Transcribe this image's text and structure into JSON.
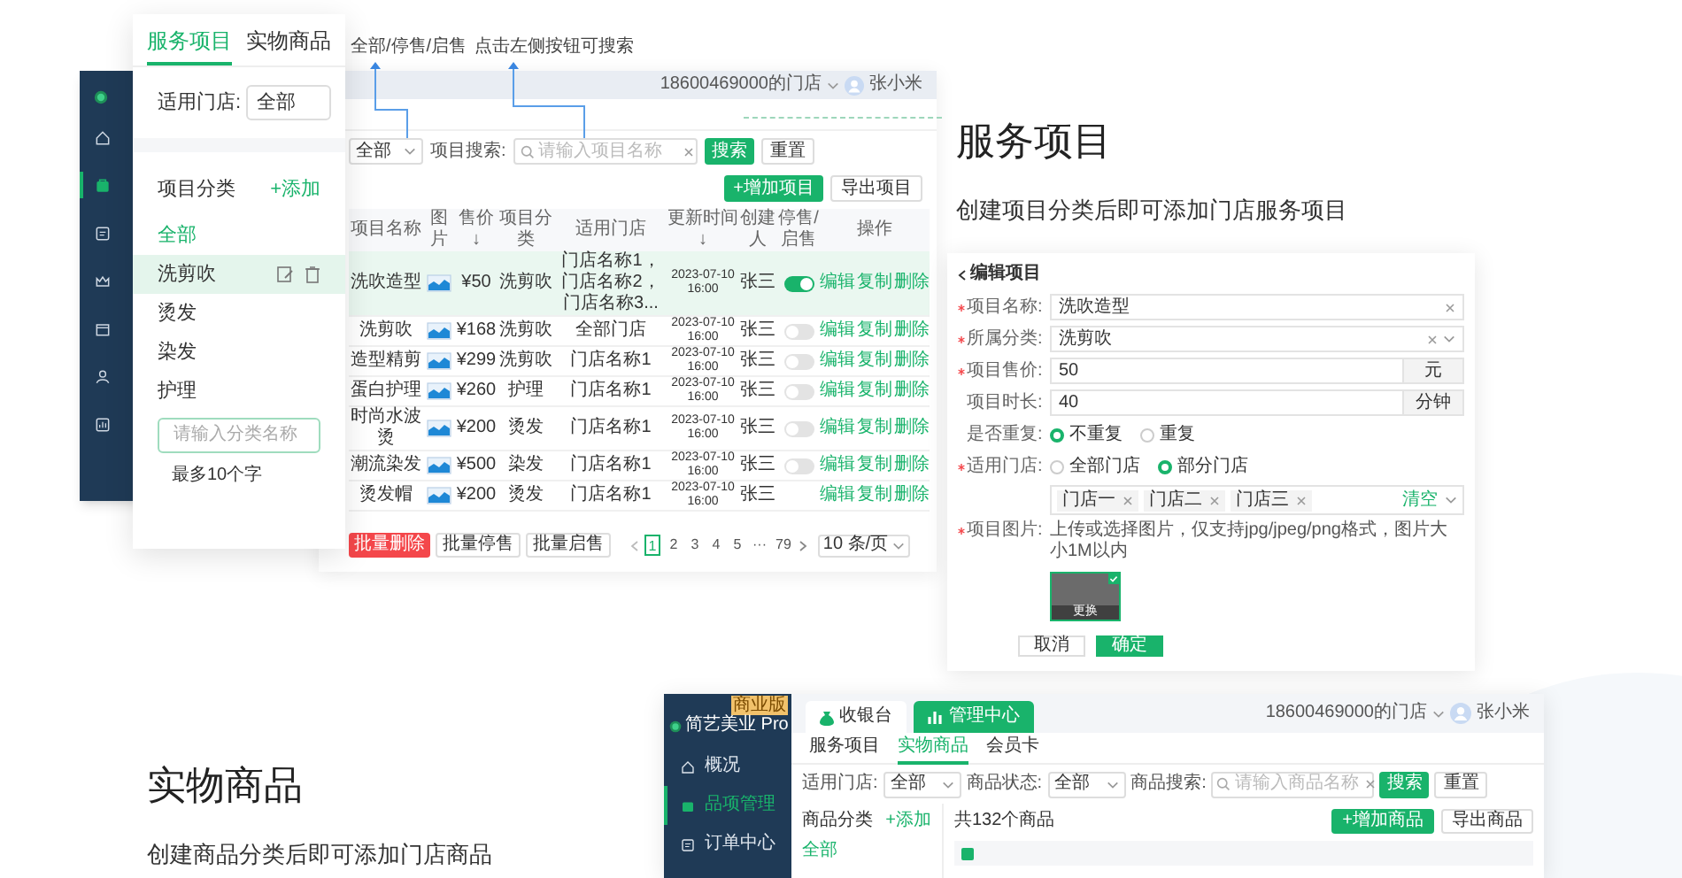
{
  "left_sidebar": {
    "items": [
      {
        "selected": false
      },
      {
        "selected": true
      },
      {
        "selected": false
      },
      {
        "selected": false
      },
      {
        "selected": false
      },
      {
        "selected": false
      },
      {
        "selected": false
      }
    ]
  },
  "category_panel": {
    "tabs": [
      {
        "label": "服务项目",
        "selected": true
      },
      {
        "label": "实物商品",
        "selected": false
      }
    ],
    "store_filter": {
      "label": "适用门店:",
      "value": "全部"
    },
    "heading": "项目分类",
    "add_link": "+添加",
    "categories": [
      {
        "label": "全部",
        "selected": true,
        "hovered": false
      },
      {
        "label": "洗剪吹",
        "selected": false,
        "hovered": true
      },
      {
        "label": "烫发",
        "selected": false,
        "hovered": false
      },
      {
        "label": "染发",
        "selected": false,
        "hovered": false
      },
      {
        "label": "护理",
        "selected": false,
        "hovered": false
      }
    ],
    "new_category": {
      "placeholder": "请输入分类名称"
    },
    "hint": "最多10个字"
  },
  "annotations": [
    "全部/停售/启售",
    "点击左侧按钮可搜索"
  ],
  "service_window": {
    "store": "18600469000的门店",
    "user": "张小米",
    "filter": {
      "status_value": "全部",
      "search_label": "项目搜索:",
      "search_placeholder": "请输入项目名称",
      "search_button": "搜索",
      "reset_button": "重置"
    },
    "add_button": "+增加项目",
    "export_button": "导出项目",
    "columns": [
      "项目名称",
      "图片",
      "售价↓",
      "项目分类",
      "适用门店",
      "更新时间↓",
      "创建人",
      "停售/启售",
      "操作"
    ],
    "rows": [
      {
        "name": "洗吹造型",
        "price": "¥50",
        "category": "洗剪吹",
        "stores": "门店名称1，门店名称2，门店名称3...",
        "updated": "2023-07-10 16:00",
        "creator": "张三",
        "on": true,
        "selected": true,
        "actions": [
          "编辑",
          "复制",
          "删除"
        ]
      },
      {
        "name": "洗剪吹",
        "price": "¥168",
        "category": "洗剪吹",
        "stores": "全部门店",
        "updated": "2023-07-10 16:00",
        "creator": "张三",
        "on": false,
        "selected": false,
        "actions": [
          "编辑",
          "复制",
          "删除"
        ]
      },
      {
        "name": "造型精剪",
        "price": "¥299",
        "category": "洗剪吹",
        "stores": "门店名称1",
        "updated": "2023-07-10 16:00",
        "creator": "张三",
        "on": false,
        "selected": false,
        "actions": [
          "编辑",
          "复制",
          "删除"
        ]
      },
      {
        "name": "蛋白护理",
        "price": "¥260",
        "category": "护理",
        "stores": "门店名称1",
        "updated": "2023-07-10 16:00",
        "creator": "张三",
        "on": false,
        "selected": false,
        "actions": [
          "编辑",
          "复制",
          "删除"
        ]
      },
      {
        "name": "时尚水波烫",
        "price": "¥200",
        "category": "烫发",
        "stores": "门店名称1",
        "updated": "2023-07-10 16:00",
        "creator": "张三",
        "on": false,
        "selected": false,
        "actions": [
          "编辑",
          "复制",
          "删除"
        ]
      },
      {
        "name": "潮流染发",
        "price": "¥500",
        "category": "染发",
        "stores": "门店名称1",
        "updated": "2023-07-10 16:00",
        "creator": "张三",
        "on": false,
        "selected": false,
        "actions": [
          "编辑",
          "复制",
          "删除"
        ]
      },
      {
        "name": "烫发帽",
        "price": "¥200",
        "category": "烫发",
        "stores": "门店名称1",
        "updated": "2023-07-10 16:00",
        "creator": "张三",
        "selected": false,
        "actions": [
          "编辑",
          "复制",
          "删除"
        ]
      }
    ],
    "bulk_buttons": [
      {
        "label": "批量删除",
        "kind": "danger"
      },
      {
        "label": "批量停售",
        "kind": "plain"
      },
      {
        "label": "批量启售",
        "kind": "plain"
      }
    ],
    "pages": [
      {
        "label": "1",
        "selected": true
      },
      {
        "label": "2",
        "selected": false
      },
      {
        "label": "3",
        "selected": false
      },
      {
        "label": "4",
        "selected": false
      },
      {
        "label": "5",
        "selected": false
      },
      {
        "label": "···",
        "selected": false
      },
      {
        "label": "79",
        "selected": false
      }
    ],
    "page_size": "10 条/页"
  },
  "section_service": {
    "title": "服务项目",
    "subtitle": "创建项目分类后即可添加门店服务项目"
  },
  "edit_form": {
    "title": "编辑项目",
    "fields": [
      {
        "kind": "text",
        "label": "项目名称:",
        "required": true,
        "value": "洗吹造型"
      },
      {
        "kind": "select",
        "label": "所属分类:",
        "required": true,
        "value": "洗剪吹"
      },
      {
        "kind": "unit",
        "label": "项目售价:",
        "required": true,
        "value": "50",
        "unit": "元"
      },
      {
        "kind": "unit",
        "label": "项目时长:",
        "required": false,
        "value": "40",
        "unit": "分钟"
      },
      {
        "kind": "radio",
        "label": "是否重复:",
        "required": false,
        "options": [
          {
            "label": "不重复",
            "selected": true
          },
          {
            "label": "重复",
            "selected": false
          }
        ]
      },
      {
        "kind": "radio",
        "label": "适用门店:",
        "required": true,
        "options": [
          {
            "label": "全部门店",
            "selected": false
          },
          {
            "label": "部分门店",
            "selected": true
          }
        ]
      },
      {
        "kind": "tags",
        "tags": [
          "门店一",
          "门店二",
          "门店三"
        ],
        "clear": "清空"
      },
      {
        "kind": "image",
        "label": "项目图片:",
        "required": true,
        "hint": "上传或选择图片，仅支持jpg/jpeg/png格式，图片大小1M以内",
        "caption": "更换"
      }
    ],
    "buttons": [
      {
        "label": "取消",
        "kind": "plain"
      },
      {
        "label": "确定",
        "kind": "primary"
      }
    ]
  },
  "section_goods": {
    "title": "实物商品",
    "subtitle": "创建商品分类后即可添加门店商品"
  },
  "goods_window": {
    "badge": "商业版",
    "brand": "简艺美业 Pro",
    "nav": [
      {
        "label": "概况",
        "selected": false
      },
      {
        "label": "品项管理",
        "selected": true
      },
      {
        "label": "订单中心",
        "selected": false
      }
    ],
    "top_tabs": [
      {
        "label": "收银台",
        "selected": false
      },
      {
        "label": "管理中心",
        "selected": true
      }
    ],
    "store": "18600469000的门店",
    "user": "张小米",
    "sub_tabs": [
      {
        "label": "服务项目",
        "selected": false
      },
      {
        "label": "实物商品",
        "selected": true
      },
      {
        "label": "会员卡",
        "selected": false
      }
    ],
    "filters": [
      {
        "label": "适用门店:",
        "value": "全部"
      },
      {
        "label": "商品状态:",
        "value": "全部"
      }
    ],
    "search": {
      "label": "商品搜索:",
      "placeholder": "请输入商品名称",
      "button": "搜索"
    },
    "reset": "重置",
    "category_heading": "商品分类",
    "add_link": "+添加",
    "categories": [
      {
        "label": "全部",
        "selected": true
      }
    ],
    "count": "共132个商品",
    "add_button": "+增加商品",
    "export_button": "导出商品"
  }
}
